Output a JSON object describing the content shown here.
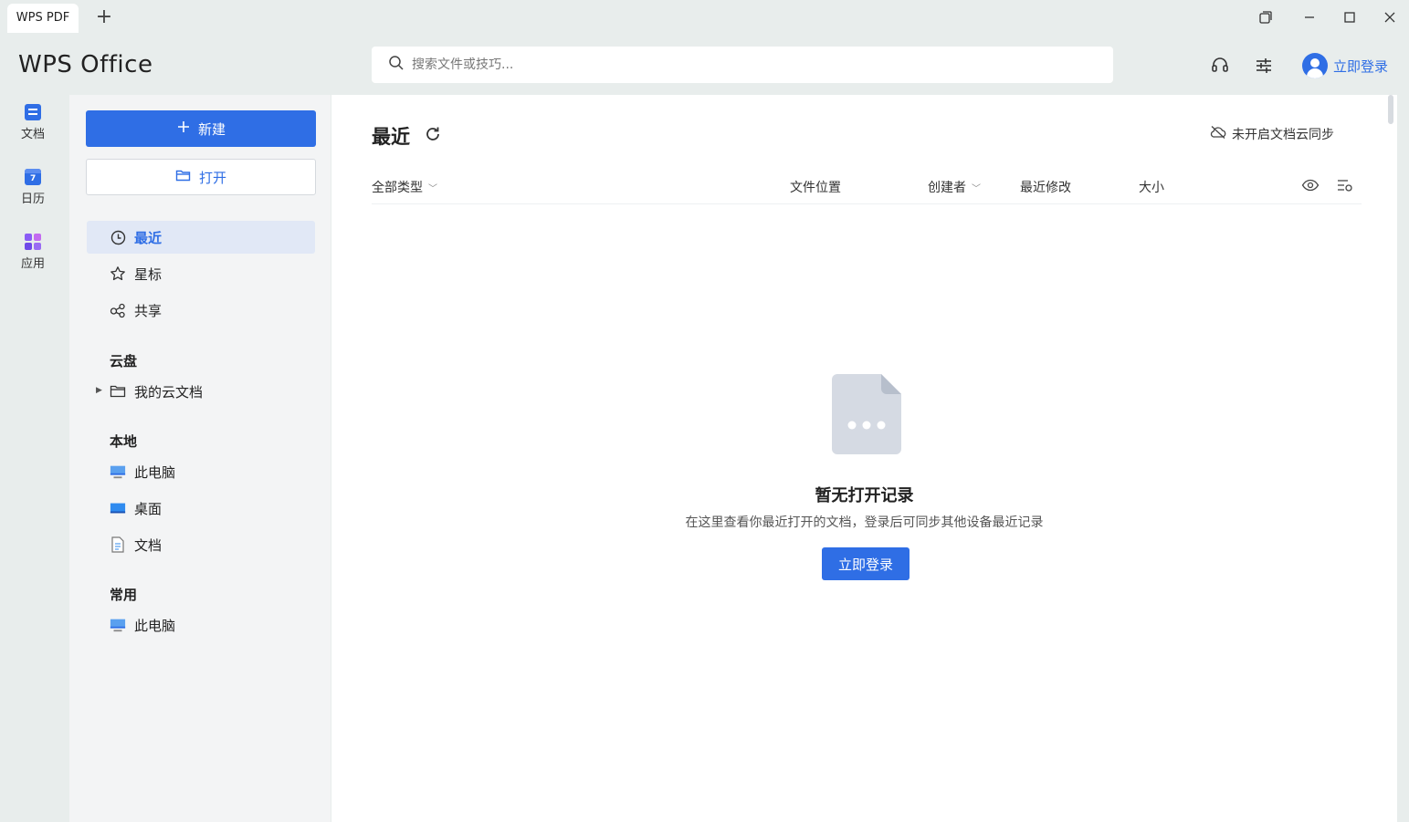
{
  "tabs": [
    {
      "label": "WPS PDF"
    }
  ],
  "tab_add": "+",
  "app": {
    "logo": "WPS Office"
  },
  "search": {
    "placeholder": "搜索文件或技巧..."
  },
  "header": {
    "login_label": "立即登录"
  },
  "rail": [
    {
      "label": "文档",
      "color": "#2f6ee5"
    },
    {
      "label": "日历",
      "color": "#2f6ee5"
    },
    {
      "label": "应用",
      "color": "#8a5cf5"
    }
  ],
  "sidebar": {
    "new_label": "新建",
    "open_label": "打开",
    "nav": [
      {
        "label": "最近"
      },
      {
        "label": "星标"
      },
      {
        "label": "共享"
      }
    ],
    "cloud_title": "云盘",
    "cloud_item": "我的云文档",
    "local_title": "本地",
    "local_items": [
      {
        "label": "此电脑"
      },
      {
        "label": "桌面"
      },
      {
        "label": "文档"
      }
    ],
    "common_title": "常用",
    "common_items": [
      {
        "label": "此电脑"
      }
    ]
  },
  "main": {
    "title": "最近",
    "sync_status": "未开启文档云同步",
    "columns": {
      "type": "全部类型",
      "location": "文件位置",
      "creator": "创建者",
      "modified": "最近修改",
      "size": "大小"
    },
    "empty": {
      "title": "暂无打开记录",
      "desc": "在这里查看你最近打开的文档，登录后可同步其他设备最近记录",
      "button": "立即登录"
    }
  },
  "colors": {
    "accent": "#2f6ee5",
    "sidebar_bg": "#f3f4f5",
    "window_bg": "#e8edec"
  }
}
